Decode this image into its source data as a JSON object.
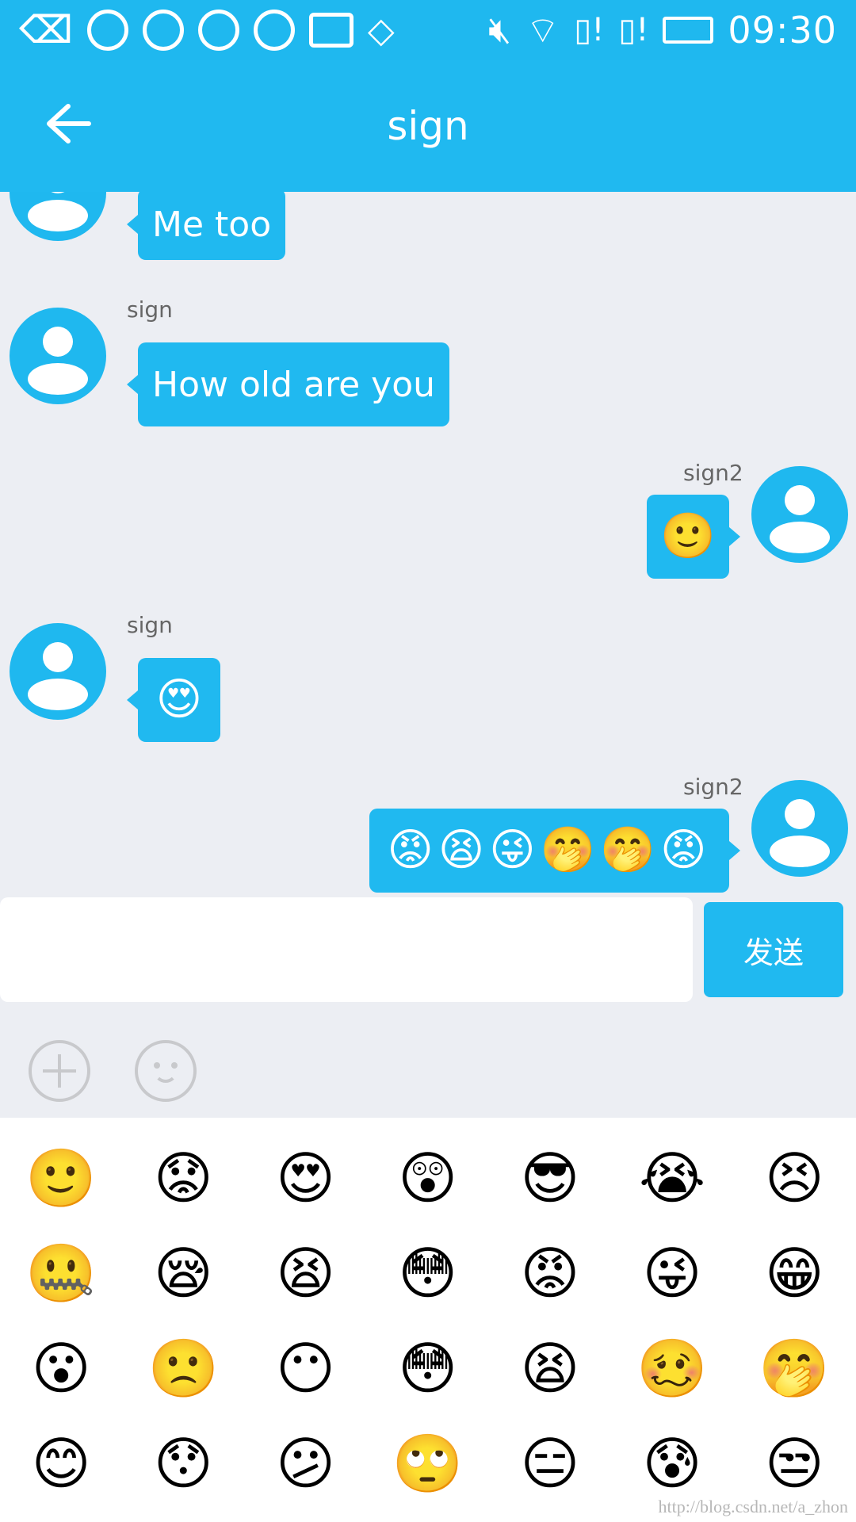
{
  "status_bar": {
    "time": "09:30",
    "icons": [
      "back-icon",
      "notification-icon",
      "notification-icon",
      "notification-icon",
      "notification-icon",
      "image-icon",
      "tag-icon",
      "mute-icon",
      "wifi-icon",
      "sim-icon",
      "sim-icon",
      "battery-icon"
    ]
  },
  "toolbar": {
    "title": "sign",
    "back_icon": "arrow-left-icon"
  },
  "messages": [
    {
      "side": "left",
      "sender": "",
      "text": "Me too"
    },
    {
      "side": "left",
      "sender": "sign",
      "text": "How old are you"
    },
    {
      "side": "right",
      "sender": "sign2",
      "text": "🙂"
    },
    {
      "side": "left",
      "sender": "sign",
      "text": "😍"
    },
    {
      "side": "right",
      "sender": "sign2",
      "text": "😡😫😜🤭🤭😡"
    }
  ],
  "input": {
    "value": "",
    "placeholder": "",
    "send_label": "发送"
  },
  "tools": [
    "plus-circle-icon",
    "smile-icon"
  ],
  "emoji_grid": [
    "🙂",
    "😟",
    "😍",
    "😲",
    "😎",
    "😭",
    "😣",
    "🤐",
    "😪",
    "😫",
    "😳",
    "😡",
    "😜",
    "😁",
    "😮",
    "🙁",
    "😶",
    "😳",
    "😫",
    "🥴",
    "🤭",
    "😊",
    "😯",
    "😕",
    "🙄",
    "😑",
    "😰",
    "😒"
  ],
  "watermark": "http://blog.csdn.net/a_zhon"
}
